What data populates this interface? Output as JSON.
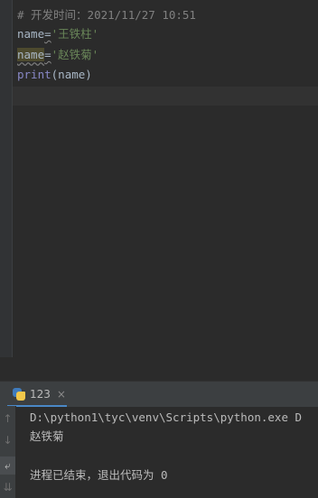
{
  "editor": {
    "comment": "# 开发时间：2021/11/27 10:51",
    "line2": {
      "var": "name",
      "op": "=",
      "str": "'王铁柱'"
    },
    "line3": {
      "var": "name",
      "op": "=",
      "str": "'赵铁菊'"
    },
    "line4": {
      "func": "print",
      "open": "(",
      "arg": "name",
      "close": ")"
    }
  },
  "run_panel": {
    "tab_label": "123",
    "close_symbol": "×",
    "toolbar": {
      "up_icon": "↑",
      "down_icon": "↓",
      "wrap_icon": "⤶",
      "scroll_icon": "⇊"
    },
    "console": {
      "command": "D:\\python1\\tyc\\venv\\Scripts\\python.exe D",
      "output": "赵铁菊",
      "exit_message": "进程已结束，退出代码为 0"
    }
  },
  "colors": {
    "background": "#2b2b2b",
    "comment": "#808080",
    "string": "#6a8759",
    "builtin": "#8888c6",
    "text": "#a9b7c6",
    "tab_accent": "#4a88c7"
  }
}
